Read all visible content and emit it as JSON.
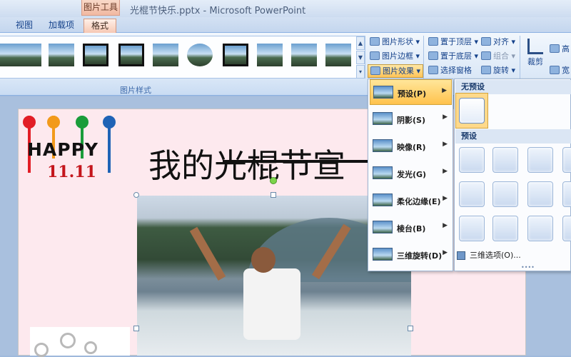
{
  "titlebar": {
    "context_tools": "图片工具",
    "window_title": "光棍节快乐.pptx - Microsoft PowerPoint"
  },
  "tabs": [
    {
      "label": "视图"
    },
    {
      "label": "加载项"
    },
    {
      "label": "格式",
      "active": true
    }
  ],
  "ribbon": {
    "gallery_group_label": "图片样式",
    "picture_buttons": {
      "shape": "图片形状 ▾",
      "border": "图片边框 ▾",
      "effects": "图片效果 ▾"
    },
    "arrange": {
      "bring_front": "置于顶层 ▾",
      "send_back": "置于底层 ▾",
      "selection_pane": "选择窗格",
      "align": "对齐 ▾",
      "group": "组合 ▾",
      "rotate": "旋转 ▾"
    },
    "size": {
      "crop": "裁剪",
      "height": "高",
      "width": "宽"
    },
    "scroll": {
      "up": "▲",
      "down": "▼",
      "more": "▾"
    }
  },
  "slide": {
    "happy": "HAPPY",
    "happy_number": "11.11",
    "title": "我的光棍节宣"
  },
  "effects_menu": {
    "items": [
      {
        "label": "预设(P)",
        "active": true
      },
      {
        "label": "阴影(S)"
      },
      {
        "label": "映像(R)"
      },
      {
        "label": "发光(G)"
      },
      {
        "label": "柔化边缘(E)"
      },
      {
        "label": "棱台(B)"
      },
      {
        "label": "三维旋转(D)"
      }
    ],
    "arrow": "▶"
  },
  "preset_submenu": {
    "no_preset_header": "无预设",
    "preset_header": "预设",
    "footer": "三维选项(O)...",
    "grip": "••••"
  },
  "colors": {
    "accent_orange": "#ffc458",
    "ribbon_blue": "#dbe8f7",
    "slide_pink": "#fde9ee",
    "happy_red": "#c4161c"
  }
}
